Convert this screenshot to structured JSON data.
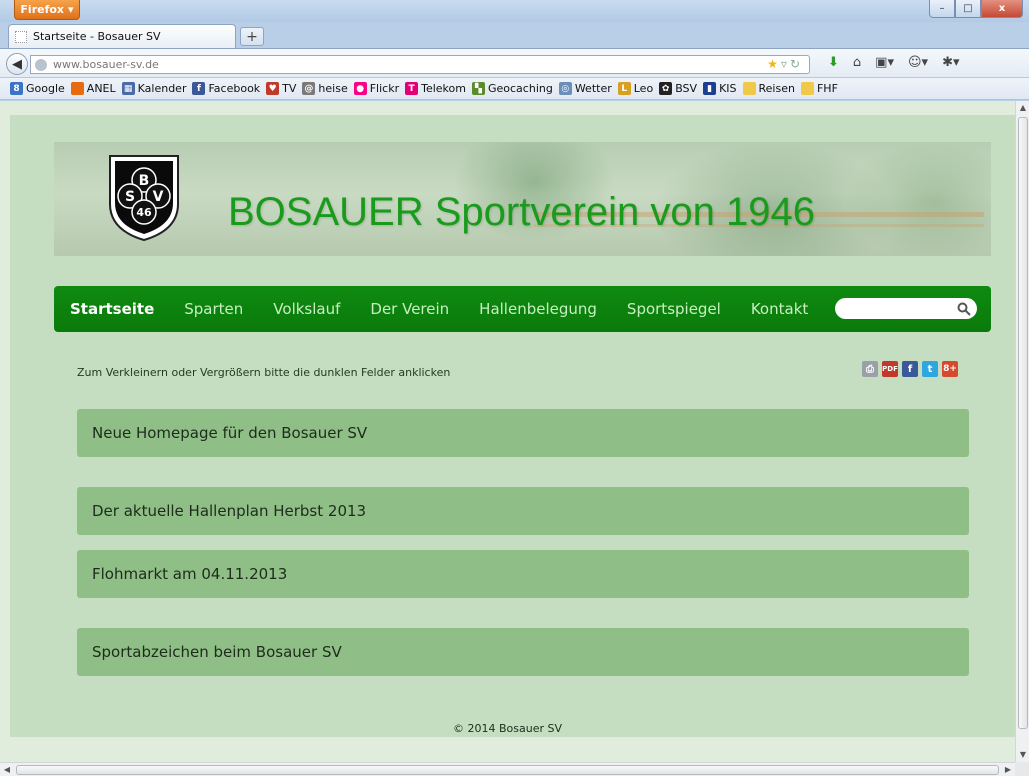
{
  "browser": {
    "menu_button": "Firefox",
    "tab_title": "Startseite - Bosauer SV",
    "new_tab": "+",
    "url": "www.bosauer-sv.de",
    "window_buttons": {
      "minimize": "–",
      "maximize": "□",
      "close": "x"
    }
  },
  "bookmarks": [
    {
      "label": "Google",
      "icon": "google-icon",
      "color": "#3b73c7",
      "glyph": "8"
    },
    {
      "label": "ANEL",
      "icon": "anel-icon",
      "color": "#e86b12",
      "glyph": ""
    },
    {
      "label": "Kalender",
      "icon": "calendar-icon",
      "color": "#4a6aa8",
      "glyph": "▦"
    },
    {
      "label": "Facebook",
      "icon": "facebook-icon",
      "color": "#3b5998",
      "glyph": "f"
    },
    {
      "label": "TV",
      "icon": "tv-icon",
      "color": "#c0392b",
      "glyph": "♥"
    },
    {
      "label": "heise",
      "icon": "heise-icon",
      "color": "#7a7a7a",
      "glyph": "@"
    },
    {
      "label": "Flickr",
      "icon": "flickr-icon",
      "color": "#ff0084",
      "glyph": "●"
    },
    {
      "label": "Telekom",
      "icon": "telekom-icon",
      "color": "#e20074",
      "glyph": "T"
    },
    {
      "label": "Geocaching",
      "icon": "geocaching-icon",
      "color": "#5b8c2a",
      "glyph": "▚"
    },
    {
      "label": "Wetter",
      "icon": "weather-icon",
      "color": "#6c8fb8",
      "glyph": "◎"
    },
    {
      "label": "Leo",
      "icon": "leo-icon",
      "color": "#d8a020",
      "glyph": "L"
    },
    {
      "label": "BSV",
      "icon": "bsv-icon",
      "color": "#222222",
      "glyph": "✿"
    },
    {
      "label": "KIS",
      "icon": "kis-icon",
      "color": "#1d3f91",
      "glyph": "▮"
    },
    {
      "label": "Reisen",
      "icon": "folder-icon",
      "color": "#f0c94a",
      "glyph": ""
    },
    {
      "label": "FHF",
      "icon": "folder-icon",
      "color": "#f0c94a",
      "glyph": ""
    }
  ],
  "site": {
    "banner_title": "BOSAUER Sportverein von 1946",
    "logo_letters": {
      "top": "B",
      "left": "S",
      "right": "V",
      "bottom": "46"
    },
    "nav": [
      "Startseite",
      "Sparten",
      "Volkslauf",
      "Der Verein",
      "Hallenbelegung",
      "Sportspiegel",
      "Kontakt"
    ],
    "search_value": "",
    "hint": "Zum Verkleinern oder Vergrößern bitte die dunklen Felder anklicken",
    "share_icons": [
      "print-icon",
      "pdf-icon",
      "facebook-icon",
      "twitter-icon",
      "googleplus-icon"
    ],
    "share_labels": {
      "pdf": "PDF",
      "facebook": "f",
      "twitter": "t",
      "googleplus": "8+"
    },
    "panels": [
      "Neue Homepage für den Bosauer SV",
      "Der aktuelle Hallenplan Herbst 2013",
      "Flohmarkt am 04.11.2013",
      "Sportabzeichen beim Bosauer SV"
    ],
    "footer": "© 2014 Bosauer SV"
  },
  "colors": {
    "nav_green": "#0f8a10",
    "panel_green": "#8fbe86",
    "page_bg": "#c5dec2",
    "title_green": "#199b1c"
  }
}
